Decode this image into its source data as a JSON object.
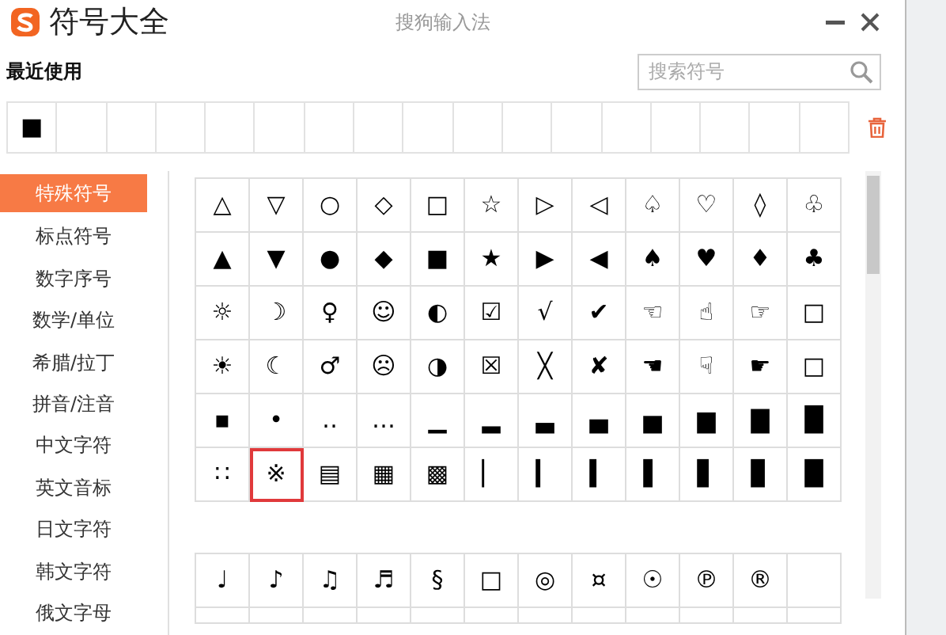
{
  "window": {
    "title": "符号大全",
    "subtitle": "搜狗输入法"
  },
  "recent": {
    "label": "最近使用",
    "symbols": [
      "■"
    ]
  },
  "search": {
    "placeholder": "搜索符号"
  },
  "sidebar": {
    "items": [
      {
        "label": "特殊符号",
        "selected": true
      },
      {
        "label": "标点符号",
        "selected": false
      },
      {
        "label": "数字序号",
        "selected": false
      },
      {
        "label": "数学/单位",
        "selected": false
      },
      {
        "label": "希腊/拉丁",
        "selected": false
      },
      {
        "label": "拼音/注音",
        "selected": false
      },
      {
        "label": "中文字符",
        "selected": false
      },
      {
        "label": "英文音标",
        "selected": false
      },
      {
        "label": "日文字符",
        "selected": false
      },
      {
        "label": "韩文字符",
        "selected": false
      },
      {
        "label": "俄文字母",
        "selected": false
      }
    ]
  },
  "symbol_groups": [
    {
      "rows": [
        [
          {
            "symbol": "△",
            "selected": false
          },
          {
            "symbol": "▽",
            "selected": false
          },
          {
            "symbol": "○",
            "selected": false
          },
          {
            "symbol": "◇",
            "selected": false
          },
          {
            "symbol": "□",
            "selected": false
          },
          {
            "symbol": "☆",
            "selected": false
          },
          {
            "symbol": "▷",
            "selected": false
          },
          {
            "symbol": "◁",
            "selected": false
          },
          {
            "symbol": "♤",
            "selected": false
          },
          {
            "symbol": "♡",
            "selected": false
          },
          {
            "symbol": "◊",
            "selected": false
          },
          {
            "symbol": "♧",
            "selected": false
          }
        ],
        [
          {
            "symbol": "▲",
            "selected": false
          },
          {
            "symbol": "▼",
            "selected": false
          },
          {
            "symbol": "●",
            "selected": false
          },
          {
            "symbol": "◆",
            "selected": false
          },
          {
            "symbol": "■",
            "selected": false
          },
          {
            "symbol": "★",
            "selected": false
          },
          {
            "symbol": "▶",
            "selected": false
          },
          {
            "symbol": "◀",
            "selected": false
          },
          {
            "symbol": "♠",
            "selected": false
          },
          {
            "symbol": "♥",
            "selected": false
          },
          {
            "symbol": "♦",
            "selected": false
          },
          {
            "symbol": "♣",
            "selected": false
          }
        ],
        [
          {
            "symbol": "☼",
            "selected": false
          },
          {
            "symbol": "☽",
            "selected": false
          },
          {
            "symbol": "♀",
            "selected": false
          },
          {
            "symbol": "☺",
            "selected": false
          },
          {
            "symbol": "◐",
            "selected": false
          },
          {
            "symbol": "☑",
            "selected": false
          },
          {
            "symbol": "√",
            "selected": false
          },
          {
            "symbol": "✔",
            "selected": false
          },
          {
            "symbol": "☜",
            "selected": false
          },
          {
            "symbol": "☝",
            "selected": false
          },
          {
            "symbol": "☞",
            "selected": false
          },
          {
            "symbol": "□",
            "selected": false
          }
        ],
        [
          {
            "symbol": "☀",
            "selected": false
          },
          {
            "symbol": "☾",
            "selected": false
          },
          {
            "symbol": "♂",
            "selected": false
          },
          {
            "symbol": "☹",
            "selected": false
          },
          {
            "symbol": "◑",
            "selected": false
          },
          {
            "symbol": "☒",
            "selected": false
          },
          {
            "symbol": "╳",
            "selected": false
          },
          {
            "symbol": "✘",
            "selected": false
          },
          {
            "symbol": "☚",
            "selected": false
          },
          {
            "symbol": "☟",
            "selected": false
          },
          {
            "symbol": "☛",
            "selected": false
          },
          {
            "symbol": "□",
            "selected": false
          }
        ],
        [
          {
            "symbol": "▪",
            "selected": false
          },
          {
            "symbol": "•",
            "selected": false
          },
          {
            "symbol": "‥",
            "selected": false
          },
          {
            "symbol": "…",
            "selected": false
          },
          {
            "symbol": "▁",
            "selected": false
          },
          {
            "symbol": "▂",
            "selected": false
          },
          {
            "symbol": "▃",
            "selected": false
          },
          {
            "symbol": "▄",
            "selected": false
          },
          {
            "symbol": "▅",
            "selected": false
          },
          {
            "symbol": "▆",
            "selected": false
          },
          {
            "symbol": "▇",
            "selected": false
          },
          {
            "symbol": "█",
            "selected": false
          }
        ],
        [
          {
            "symbol": "∷",
            "selected": false
          },
          {
            "symbol": "※",
            "selected": true
          },
          {
            "symbol": "▤",
            "selected": false
          },
          {
            "symbol": "▦",
            "selected": false
          },
          {
            "symbol": "▩",
            "selected": false
          },
          {
            "symbol": "▏",
            "selected": false
          },
          {
            "symbol": "▎",
            "selected": false
          },
          {
            "symbol": "▍",
            "selected": false
          },
          {
            "symbol": "▌",
            "selected": false
          },
          {
            "symbol": "▋",
            "selected": false
          },
          {
            "symbol": "▊",
            "selected": false
          },
          {
            "symbol": "█",
            "selected": false
          }
        ]
      ]
    },
    {
      "rows": [
        [
          {
            "symbol": "♩",
            "selected": false
          },
          {
            "symbol": "♪",
            "selected": false
          },
          {
            "symbol": "♫",
            "selected": false
          },
          {
            "symbol": "♬",
            "selected": false
          },
          {
            "symbol": "§",
            "selected": false
          },
          {
            "symbol": "□",
            "selected": false
          },
          {
            "symbol": "◎",
            "selected": false
          },
          {
            "symbol": "¤",
            "selected": false
          },
          {
            "symbol": "☉",
            "selected": false
          },
          {
            "symbol": "℗",
            "selected": false
          },
          {
            "symbol": "®",
            "selected": false
          }
        ]
      ]
    }
  ]
}
